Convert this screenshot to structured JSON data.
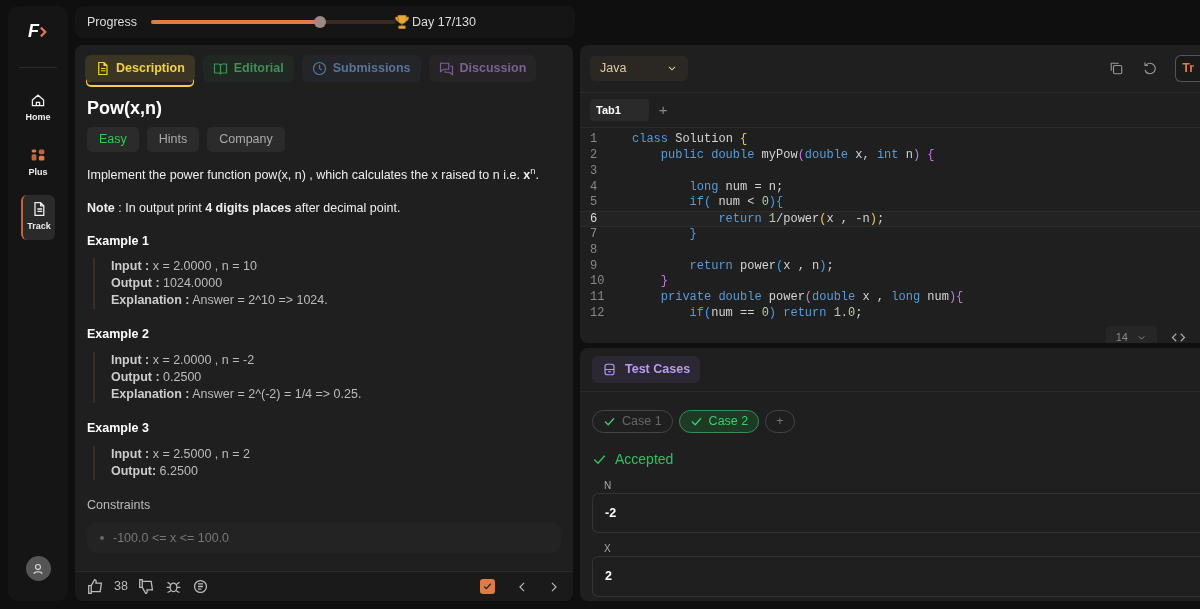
{
  "sidebar": {
    "logo": "F",
    "items": [
      {
        "label": "Home",
        "selected": false
      },
      {
        "label": "Plus",
        "selected": false
      },
      {
        "label": "Track",
        "selected": true
      }
    ]
  },
  "progress": {
    "label": "Progress",
    "level": 0.69,
    "day": "Day 17/130"
  },
  "problem_tabs": [
    {
      "label": "Description",
      "color": "#f5d142",
      "selected": true
    },
    {
      "label": "Editorial",
      "color": "#3f8f58",
      "selected": false
    },
    {
      "label": "Submissions",
      "color": "#5a7398",
      "selected": false
    },
    {
      "label": "Discussion",
      "color": "#7c6190",
      "selected": false
    }
  ],
  "problem": {
    "title": "Pow(x,n)",
    "tags": [
      {
        "label": "Easy",
        "kind": "difficulty"
      },
      {
        "label": "Hints",
        "kind": "plain"
      },
      {
        "label": "Company",
        "kind": "plain"
      }
    ],
    "statement": "Implement the power function pow(x, n) , which calculates the x raised to n i.e. **x**$^{n}$.",
    "note": "**Note** : In output print **4 digits places** after decimal point.",
    "examples": [
      {
        "title": "Example 1",
        "lines": [
          "**Input :** x = 2.0000 , n = 10",
          "**Output :** 1024.0000",
          "**Explanation :** Answer = 2^10 => 1024."
        ]
      },
      {
        "title": "Example 2",
        "lines": [
          "**Input :** x = 2.0000 , n = -2",
          "**Output :** 0.2500",
          "**Explanation :** Answer = 2^(-2) = 1/4 => 0.25."
        ]
      },
      {
        "title": "Example 3",
        "lines": [
          "**Input :** x = 2.5000 , n = 2",
          "**Output:**  6.2500"
        ]
      }
    ],
    "constraints_title": "Constraints",
    "constraints": [
      "-100.0 <= x <= 100.0"
    ]
  },
  "footer": {
    "likes": "38",
    "solved_checked": true
  },
  "editor": {
    "language": "Java",
    "cut_button": "Tr",
    "tabs": [
      {
        "label": "Tab1",
        "selected": true
      }
    ],
    "add_tab": "+",
    "font_size": "14",
    "lines": [
      {
        "number": "1",
        "active": false,
        "tokens": [
          {
            "kind": "keyword",
            "text": "class"
          },
          {
            "kind": "plain",
            "text": " Solution "
          },
          {
            "kind": "bracket1",
            "text": "{"
          }
        ]
      },
      {
        "number": "2",
        "active": false,
        "tokens": [
          {
            "kind": "keyword",
            "text": "    public double"
          },
          {
            "kind": "plain",
            "text": " myPow"
          },
          {
            "kind": "bracket2",
            "text": "("
          },
          {
            "kind": "keyword",
            "text": "double"
          },
          {
            "kind": "plain",
            "text": " x, "
          },
          {
            "kind": "keyword",
            "text": "int"
          },
          {
            "kind": "plain",
            "text": " n"
          },
          {
            "kind": "bracket2",
            "text": ")"
          },
          {
            "kind": "bracket2",
            "text": " {"
          }
        ]
      },
      {
        "number": "3",
        "active": false
      },
      {
        "number": "4",
        "active": false,
        "tokens": [
          {
            "kind": "keyword",
            "text": "        long"
          },
          {
            "kind": "plain",
            "text": " num = n;"
          }
        ]
      },
      {
        "number": "5",
        "active": false,
        "tokens": [
          {
            "kind": "keyword",
            "text": "        if"
          },
          {
            "kind": "bracket3",
            "text": "("
          },
          {
            "kind": "plain",
            "text": " num < "
          },
          {
            "kind": "number",
            "text": "0"
          },
          {
            "kind": "bracket3",
            "text": ")"
          },
          {
            "kind": "bracket3",
            "text": "{"
          }
        ]
      },
      {
        "number": "6",
        "active": true,
        "tokens": [
          {
            "kind": "keyword",
            "text": "            return"
          },
          {
            "kind": "number",
            "text": " 1"
          },
          {
            "kind": "plain",
            "text": "/power"
          },
          {
            "kind": "bracket1",
            "text": "("
          },
          {
            "kind": "plain",
            "text": "x , -n"
          },
          {
            "kind": "bracket1",
            "text": ")"
          },
          {
            "kind": "plain",
            "text": ";"
          }
        ]
      },
      {
        "number": "7",
        "active": false,
        "tokens": [
          {
            "kind": "bracket3",
            "text": "        }"
          }
        ]
      },
      {
        "number": "8",
        "active": false
      },
      {
        "number": "9",
        "active": false,
        "tokens": [
          {
            "kind": "keyword",
            "text": "        return"
          },
          {
            "kind": "plain",
            "text": " power"
          },
          {
            "kind": "bracket3",
            "text": "("
          },
          {
            "kind": "plain",
            "text": "x , n"
          },
          {
            "kind": "bracket3",
            "text": ")"
          },
          {
            "kind": "plain",
            "text": ";"
          }
        ]
      },
      {
        "number": "10",
        "active": false,
        "tokens": [
          {
            "kind": "bracket2",
            "text": "    }"
          }
        ]
      },
      {
        "number": "11",
        "active": false,
        "tokens": [
          {
            "kind": "keyword",
            "text": "    private double"
          },
          {
            "kind": "plain",
            "text": " power"
          },
          {
            "kind": "bracket2",
            "text": "("
          },
          {
            "kind": "keyword",
            "text": "double"
          },
          {
            "kind": "plain",
            "text": " x , "
          },
          {
            "kind": "keyword",
            "text": "long"
          },
          {
            "kind": "plain",
            "text": " num"
          },
          {
            "kind": "bracket2",
            "text": ")"
          },
          {
            "kind": "bracket2",
            "text": "{"
          }
        ]
      },
      {
        "number": "12",
        "active": false,
        "tokens": [
          {
            "kind": "keyword",
            "text": "        if"
          },
          {
            "kind": "bracket3",
            "text": "("
          },
          {
            "kind": "plain",
            "text": "num == "
          },
          {
            "kind": "number",
            "text": "0"
          },
          {
            "kind": "bracket3",
            "text": ")"
          },
          {
            "kind": "keyword",
            "text": " return"
          },
          {
            "kind": "number",
            "text": " 1.0"
          },
          {
            "kind": "plain",
            "text": ";"
          }
        ]
      }
    ]
  },
  "test_panel": {
    "tab": "Test Cases",
    "cases": [
      {
        "label": "Case 1",
        "passed": true,
        "selected": false
      },
      {
        "label": "Case 2",
        "passed": true,
        "selected": true
      }
    ],
    "add_case": "+",
    "result": "Accepted",
    "inputs": [
      {
        "label": "N",
        "value": "-2"
      },
      {
        "label": "X",
        "value": "2"
      }
    ]
  }
}
